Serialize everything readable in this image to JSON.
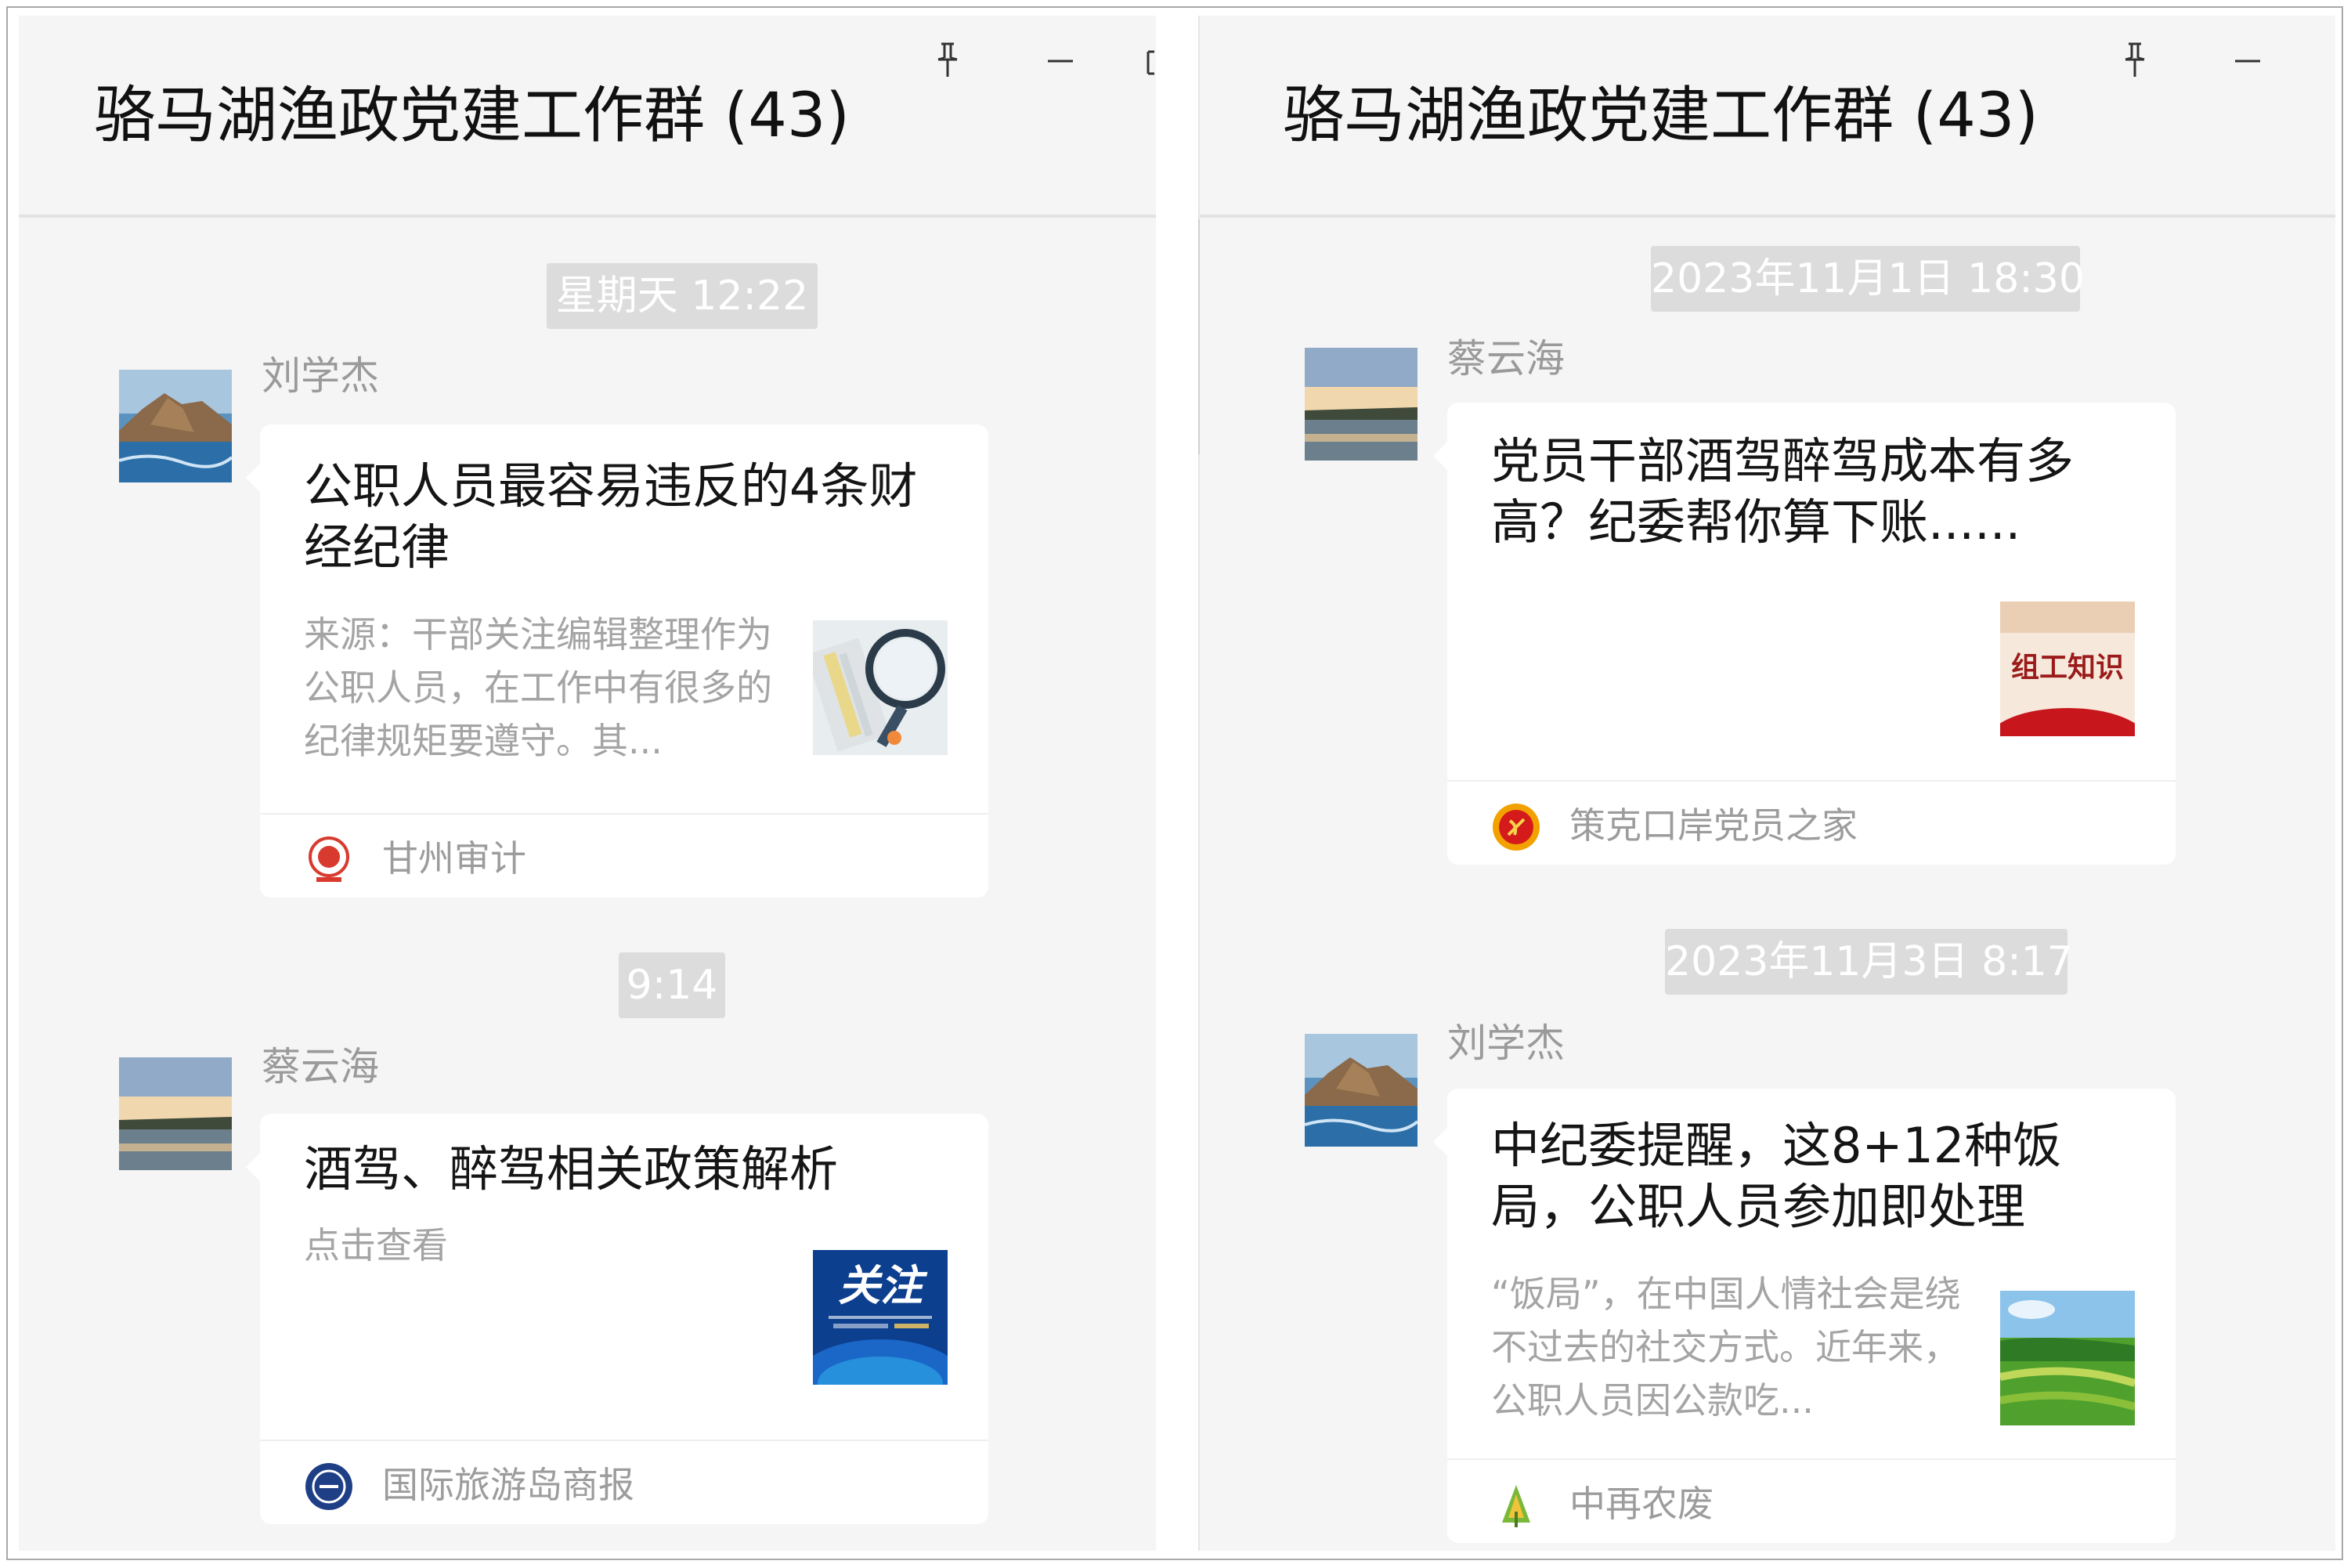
{
  "left_window": {
    "title": "骆马湖渔政党建工作群 (43)",
    "messages": [
      {
        "timestamp": "星期天 12:22",
        "sender": "刘学杰",
        "card_title": "公职人员最容易违反的4条财经纪律",
        "card_desc": "来源：干部关注编辑整理作为公职人员，在工作中有很多的纪律规矩要遵守。其...",
        "source": "甘州审计"
      },
      {
        "timestamp": "9:14",
        "sender": "蔡云海",
        "card_title": "酒驾、醉驾相关政策解析",
        "card_desc": "点击查看",
        "thumb_text": "关注",
        "source": "国际旅游岛商报"
      }
    ]
  },
  "right_window": {
    "title": "骆马湖渔政党建工作群 (43)",
    "messages": [
      {
        "timestamp": "2023年11月1日 18:30",
        "sender": "蔡云海",
        "card_title": "党员干部酒驾醉驾成本有多高？纪委帮你算下账......",
        "thumb_text": "组工知识",
        "source": "策克口岸党员之家"
      },
      {
        "timestamp": "2023年11月3日 8:17",
        "sender": "刘学杰",
        "card_title": "中纪委提醒，这8+12种饭局，公职人员参加即处理",
        "card_desc": "“饭局”，在中国人情社会是绕不过去的社交方式。近年来，公职人员因公款吃...",
        "source": "中再农废"
      }
    ]
  },
  "colors": {
    "panel_bg": "#f5f5f5",
    "card_bg": "#ffffff",
    "timestamp_bg": "#dcdcdc",
    "muted_text": "#9a9a9a",
    "party_red": "#c8161d"
  },
  "icons": [
    "pin-icon",
    "minimize-icon"
  ]
}
